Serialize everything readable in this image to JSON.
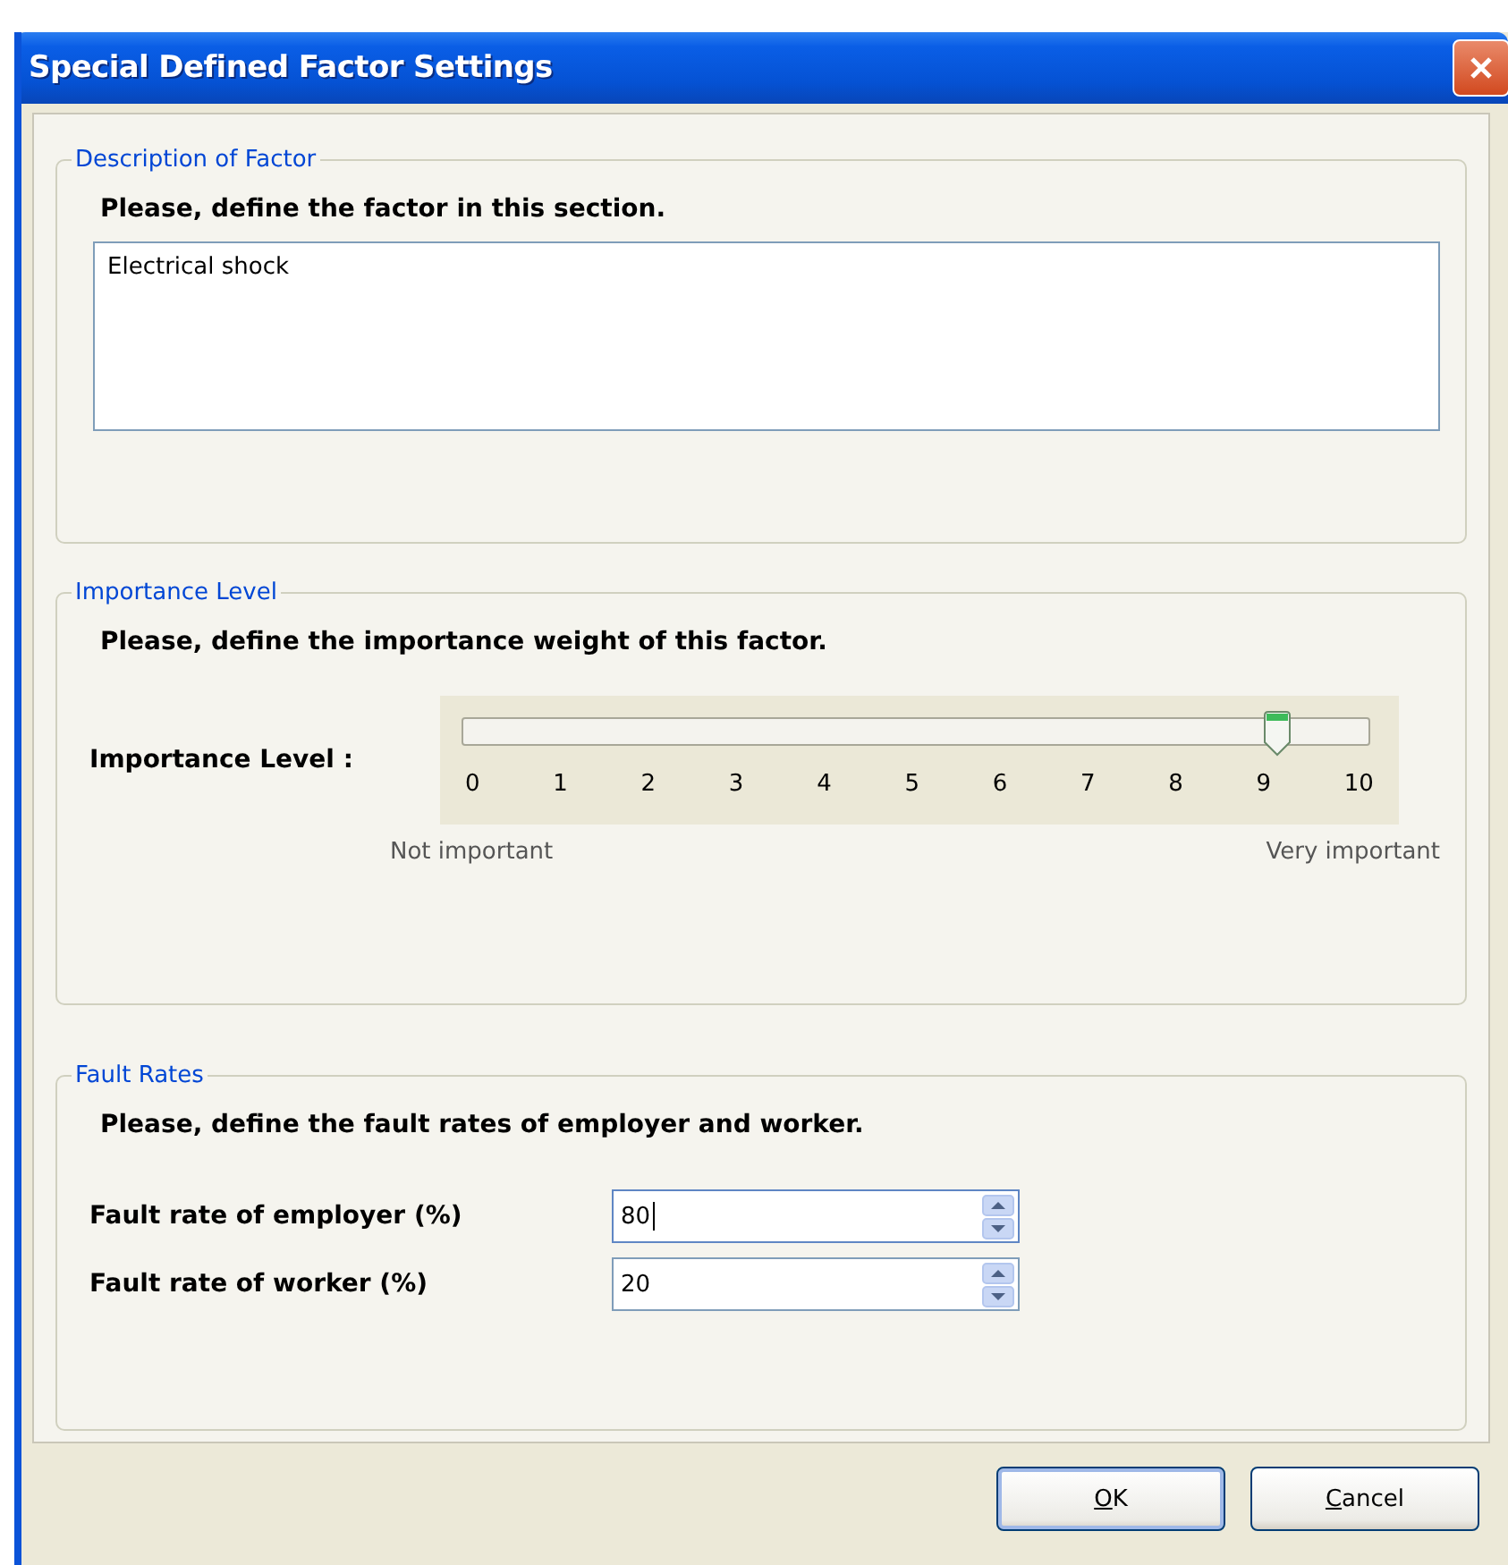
{
  "window": {
    "title": "Special Defined Factor Settings"
  },
  "description": {
    "legend": "Description of Factor",
    "instruction": "Please, define the factor in this section.",
    "value": "Electrical shock"
  },
  "importance": {
    "legend": "Importance Level",
    "instruction": "Please, define the importance weight of this factor.",
    "label": "Importance Level :",
    "level": 0.9,
    "ticks": [
      "0",
      "1",
      "2",
      "3",
      "4",
      "5",
      "6",
      "7",
      "8",
      "9",
      "10"
    ],
    "min_caption": "Not important",
    "max_caption": "Very important"
  },
  "fault_rates": {
    "legend": "Fault Rates",
    "instruction": "Please, define the fault rates of employer and worker.",
    "fields": [
      {
        "label": "Fault rate of employer (%)",
        "value": "80",
        "focused": true
      },
      {
        "label": "Fault rate of worker (%)",
        "value": "20",
        "focused": false
      }
    ]
  },
  "buttons": [
    {
      "label": "OK",
      "default": true
    },
    {
      "label": "Cancel",
      "default": false
    }
  ]
}
